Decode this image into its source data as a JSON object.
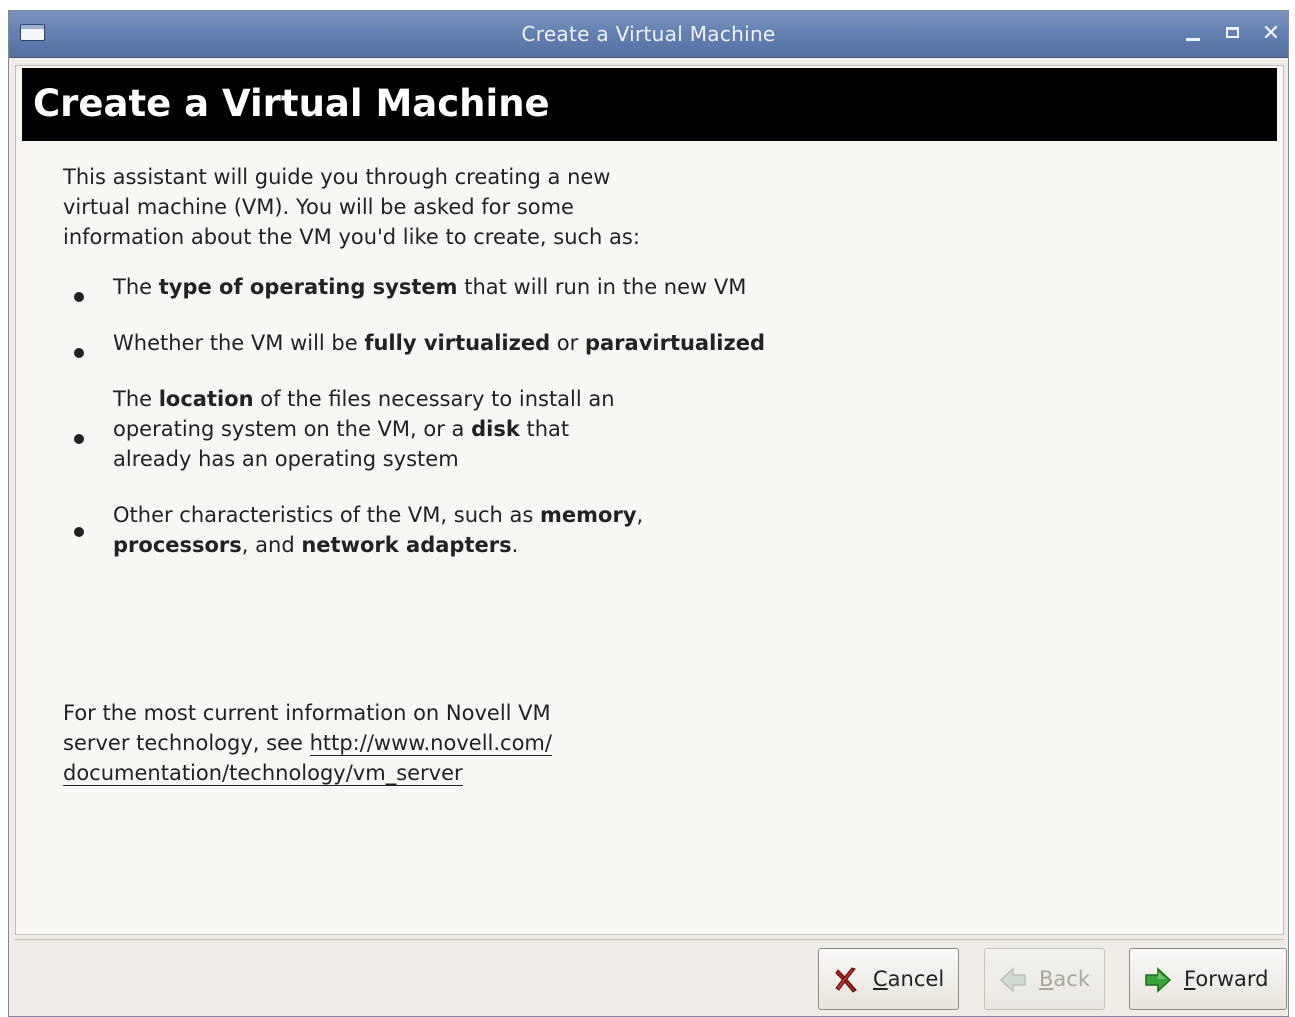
{
  "window": {
    "title": "Create a Virtual Machine"
  },
  "header": {
    "title": "Create a Virtual Machine"
  },
  "intro": "This assistant will guide you through creating a new virtual machine (VM).  You will be asked for some information about the VM you'd like to create, such as:",
  "bullets": [
    [
      "The ",
      "type of operating system",
      " that will run in the new VM"
    ],
    [
      "Whether the VM will be ",
      "fully virtualized",
      " or ",
      "paravirtualized"
    ],
    [
      "The ",
      "location",
      " of the files necessary to install an",
      "operating system on the VM, or a ",
      "disk",
      " that",
      "already has an operating system"
    ],
    [
      "Other characteristics of the VM, such as ",
      "memory",
      ",",
      "processors",
      ", and ",
      "network adapters",
      "."
    ]
  ],
  "footer": {
    "text": "For the most current information on Novell VM server technology, see ",
    "link_line1": "http://www.novell.com/",
    "link_line2": "documentation/technology/vm_server"
  },
  "buttons": {
    "cancel": "Cancel",
    "back": "Back",
    "forward": "Forward"
  },
  "colors": {
    "titlebar": "#6581b4",
    "header_bg": "#000000",
    "content_bg": "#f8f7f3",
    "window_bg": "#efebe6",
    "cancel_icon": "#a8201a",
    "forward_icon": "#3aa53a"
  },
  "icons": {
    "window_menu": "window-menu-icon",
    "minimize": "minimize-icon",
    "maximize": "maximize-icon",
    "close": "close-icon",
    "cancel": "cancel-x-icon",
    "back": "back-arrow-icon",
    "forward": "forward-arrow-icon"
  }
}
